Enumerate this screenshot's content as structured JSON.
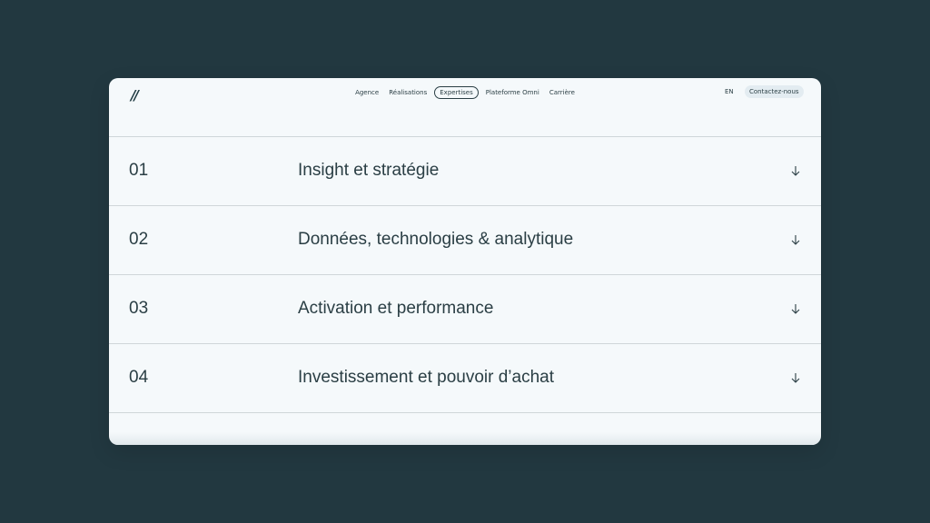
{
  "header": {
    "logo_text": "//",
    "nav": [
      {
        "label": "Agence",
        "active": false
      },
      {
        "label": "Réalisations",
        "active": false
      },
      {
        "label": "Expertises",
        "active": true
      },
      {
        "label": "Plateforme Omni",
        "active": false
      },
      {
        "label": "Carrière",
        "active": false
      }
    ],
    "lang": "EN",
    "contact_label": "Contactez-nous"
  },
  "expertises": [
    {
      "number": "01",
      "title": "Insight et stratégie",
      "icon": "arrow-down-icon"
    },
    {
      "number": "02",
      "title": "Données, technologies & analytique",
      "icon": "arrow-down-icon"
    },
    {
      "number": "03",
      "title": "Activation et performance",
      "icon": "arrow-down-icon"
    },
    {
      "number": "04",
      "title": "Investissement et pouvoir d’achat",
      "icon": "arrow-down-icon"
    }
  ],
  "colors": {
    "background": "#223840",
    "panel": "#f5f9fb",
    "text": "#2a3e44",
    "divider": "#cfd6d9"
  }
}
